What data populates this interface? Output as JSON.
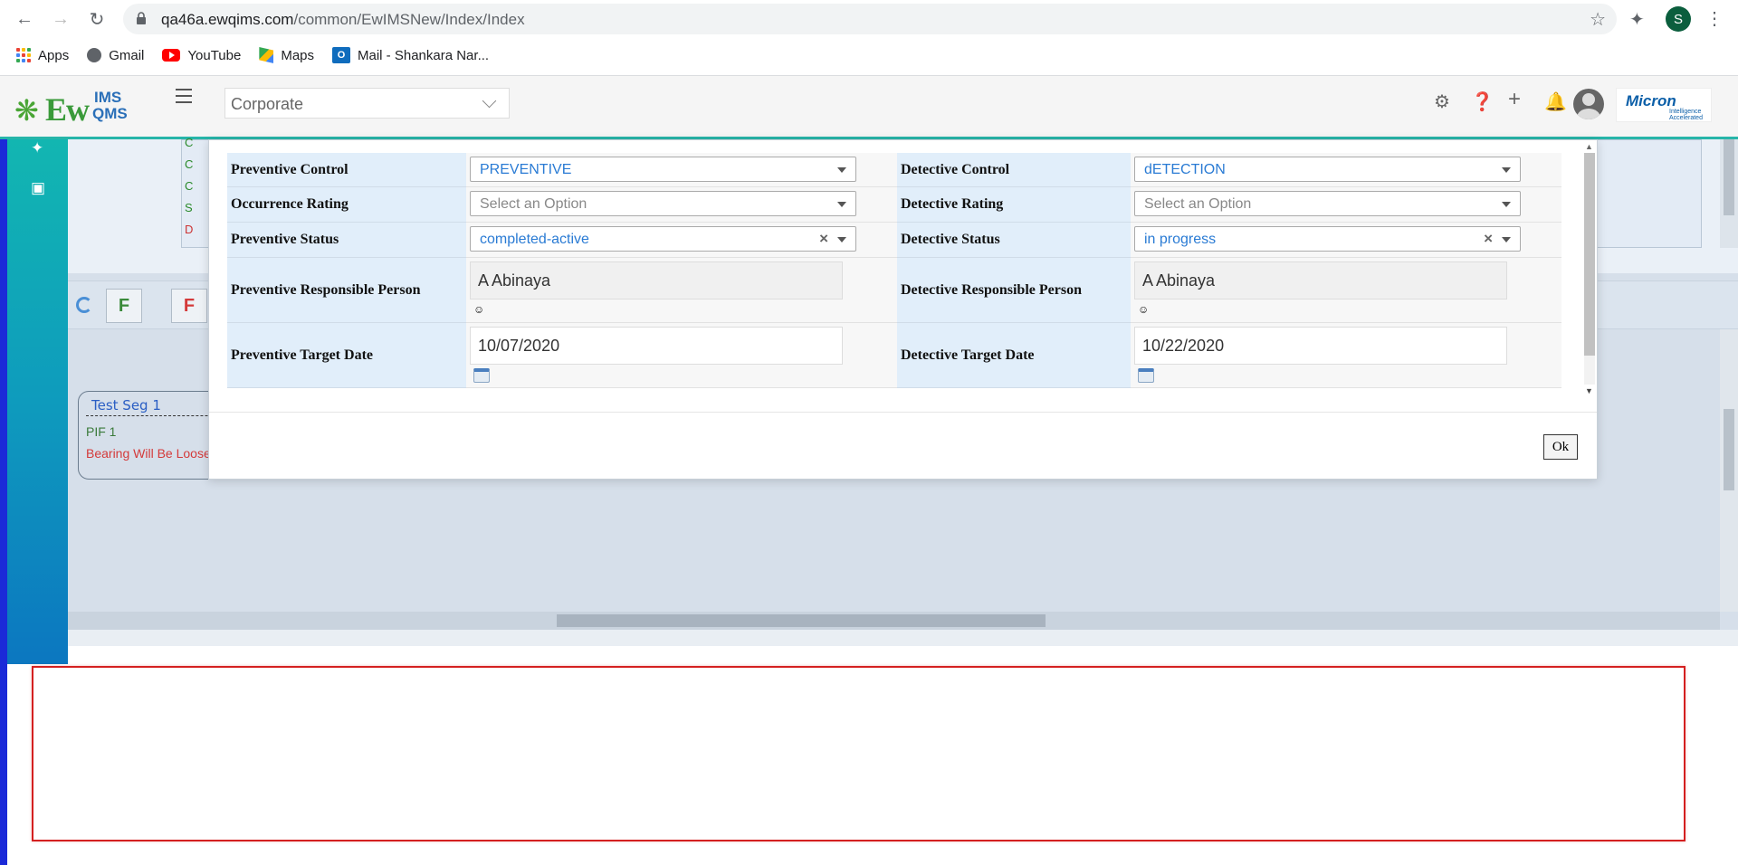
{
  "browser": {
    "url_host": "qa46a.ewqims.com",
    "url_path": "/common/EwIMSNew/Index/Index",
    "profile_initial": "S",
    "bookmarks": [
      {
        "label": "Apps",
        "icon": "apps-grid-icon"
      },
      {
        "label": "Gmail",
        "icon": "globe-icon"
      },
      {
        "label": "YouTube",
        "icon": "youtube-icon"
      },
      {
        "label": "Maps",
        "icon": "maps-icon"
      },
      {
        "label": "Mail - Shankara Nar...",
        "icon": "outlook-icon"
      }
    ]
  },
  "header": {
    "logo_text": "Ew",
    "logo_ims": "IMS",
    "logo_qms": "QMS",
    "site_select": "Corporate",
    "company_logo": "Micron",
    "company_tagline": "Intelligence Accelerated"
  },
  "background": {
    "toolbar_buttons": [
      "F",
      "F"
    ],
    "segment": {
      "title": "Test Seg 1",
      "pif": "PIF 1",
      "failure": "Bearing Will Be Loose"
    },
    "list_rows": [
      "C",
      "C",
      "C",
      "S",
      "D"
    ]
  },
  "modal": {
    "left": [
      {
        "label": "Preventive Control",
        "type": "select",
        "value": "PREVENTIVE",
        "placeholder": false,
        "clearable": false
      },
      {
        "label": "Occurrence Rating",
        "type": "select",
        "value": "Select an Option",
        "placeholder": true,
        "clearable": false
      },
      {
        "label": "Preventive Status",
        "type": "select",
        "value": "completed-active",
        "placeholder": false,
        "clearable": true
      },
      {
        "label": "Preventive Responsible Person",
        "type": "person",
        "value": "A Abinaya"
      },
      {
        "label": "Preventive Target Date",
        "type": "date",
        "value": "10/07/2020"
      }
    ],
    "right": [
      {
        "label": "Detective Control",
        "type": "select",
        "value": "dETECTION",
        "placeholder": false,
        "clearable": false
      },
      {
        "label": "Detective Rating",
        "type": "select",
        "value": "Select an Option",
        "placeholder": true,
        "clearable": false
      },
      {
        "label": "Detective Status",
        "type": "select",
        "value": "in progress",
        "placeholder": false,
        "clearable": true
      },
      {
        "label": "Detective Responsible Person",
        "type": "person",
        "value": "A Abinaya"
      },
      {
        "label": "Detective Target Date",
        "type": "date",
        "value": "10/22/2020"
      }
    ],
    "ok_label": "Ok"
  },
  "colors": {
    "accent_teal": "#27b5a9",
    "label_bg": "#e1eefa",
    "select_text": "#2a7bd4",
    "alert_red": "#d42020"
  }
}
